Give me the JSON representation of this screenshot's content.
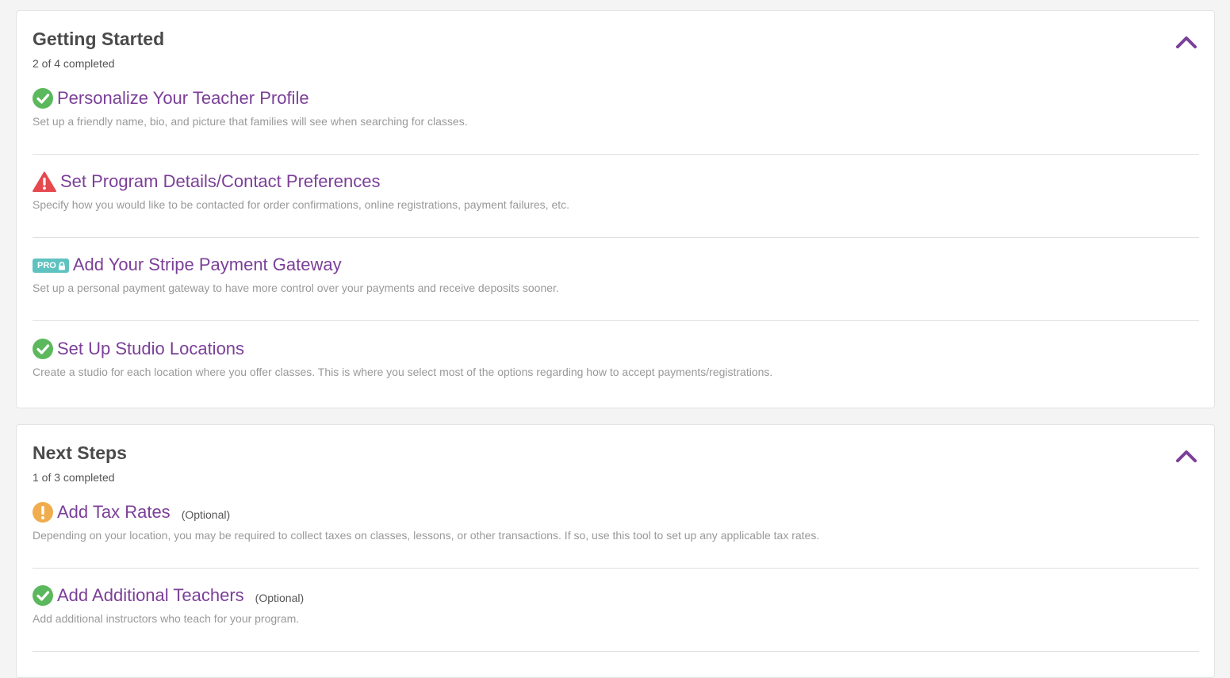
{
  "colors": {
    "accent": "#7b3f98",
    "success": "#5cb85c",
    "danger": "#e5484d",
    "warning": "#f0ad4e",
    "pro_badge": "#5ec2c0"
  },
  "sections": [
    {
      "title": "Getting Started",
      "progress": "2 of 4 completed",
      "collapse_icon": "chevron-up-icon",
      "items": [
        {
          "status": "complete",
          "icon": "check-circle-icon",
          "title": "Personalize Your Teacher Profile",
          "description": "Set up a friendly name, bio, and picture that families will see when searching for classes."
        },
        {
          "status": "error",
          "icon": "warning-triangle-icon",
          "title": "Set Program Details/Contact Preferences",
          "description": "Specify how you would like to be contacted for order confirmations, online registrations, payment failures, etc."
        },
        {
          "status": "locked",
          "icon": "lock-icon",
          "badge": "PRO",
          "title": "Add Your Stripe Payment Gateway",
          "description": "Set up a personal payment gateway to have more control over your payments and receive deposits sooner."
        },
        {
          "status": "complete",
          "icon": "check-circle-icon",
          "title": "Set Up Studio Locations",
          "description": "Create a studio for each location where you offer classes. This is where you select most of the options regarding how to accept payments/registrations."
        }
      ]
    },
    {
      "title": "Next Steps",
      "progress": "1 of 3 completed",
      "collapse_icon": "chevron-up-icon",
      "items": [
        {
          "status": "warning",
          "icon": "exclamation-circle-icon",
          "title": "Add Tax Rates",
          "optional": "(Optional)",
          "description": "Depending on your location, you may be required to collect taxes on classes, lessons, or other transactions. If so, use this tool to set up any applicable tax rates."
        },
        {
          "status": "complete",
          "icon": "check-circle-icon",
          "title": "Add Additional Teachers",
          "optional": "(Optional)",
          "description": "Add additional instructors who teach for your program."
        }
      ]
    }
  ]
}
